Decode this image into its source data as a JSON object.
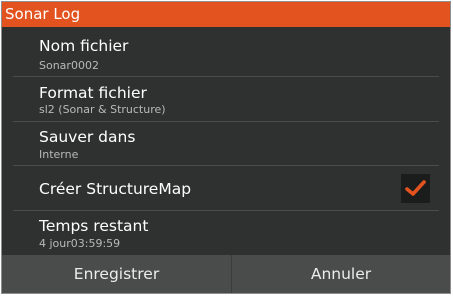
{
  "dialog": {
    "title": "Sonar Log"
  },
  "rows": {
    "filename": {
      "label": "Nom fichier",
      "value": "Sonar0002"
    },
    "fileformat": {
      "label": "Format fichier",
      "value": "sl2 (Sonar & Structure)"
    },
    "savein": {
      "label": "Sauver dans",
      "value": "Interne"
    },
    "structuremap": {
      "label": "Créer StructureMap",
      "checked": true
    },
    "timeleft": {
      "label": "Temps restant",
      "value": "4 jour03:59:59"
    }
  },
  "buttons": {
    "record": "Enregistrer",
    "cancel": "Annuler"
  },
  "colors": {
    "accent": "#e2531f",
    "background": "#2f3030",
    "button_bar": "#4a4b4b"
  },
  "icons": {
    "checkbox": "checkmark-icon"
  }
}
